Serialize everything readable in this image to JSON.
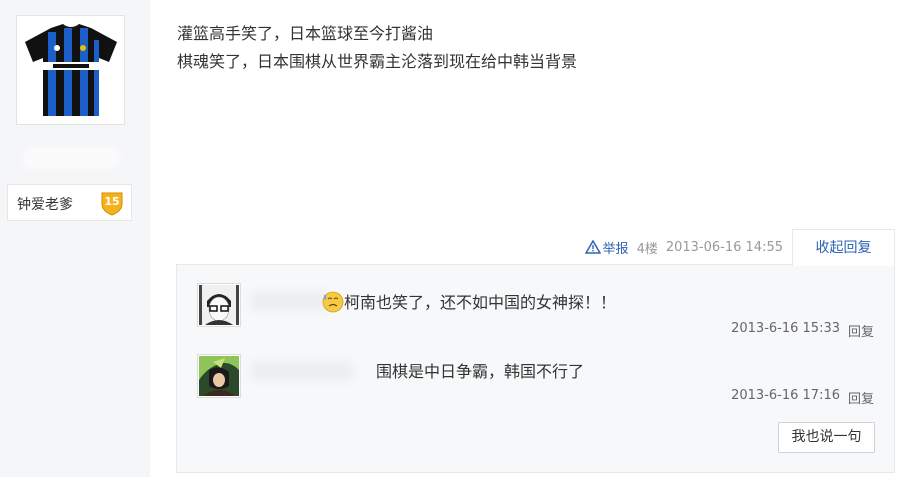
{
  "author": {
    "avatar_icon": "inter-milan-jersey-icon",
    "level_name": "钟爱老爹",
    "level": "15"
  },
  "post": {
    "lines": [
      "灌篮高手笑了，日本篮球至今打酱油",
      "棋魂笑了，日本围棋从世界霸主沦落到现在给中韩当背景"
    ]
  },
  "meta": {
    "report_label": "举报",
    "floor": "4楼",
    "date": "2013-06-16 14:55",
    "collapse_label": "收起回复"
  },
  "replies": [
    {
      "avatar_icon": "glasses-person-avatar-icon",
      "emoji_icon": "sweat-emoji-icon",
      "text": "柯南也笑了，还不如中国的女神探！！",
      "time": "2013-6-16 15:33",
      "reply_label": "回复"
    },
    {
      "avatar_icon": "anime-character-avatar-icon",
      "text": "围棋是中日争霸，韩国不行了",
      "time": "2013-6-16 17:16",
      "reply_label": "回复"
    }
  ],
  "say_button": "我也说一句",
  "colors": {
    "link": "#2d64b3",
    "badge": "#f5b21d",
    "sidebar_bg": "#f5f6f8"
  }
}
